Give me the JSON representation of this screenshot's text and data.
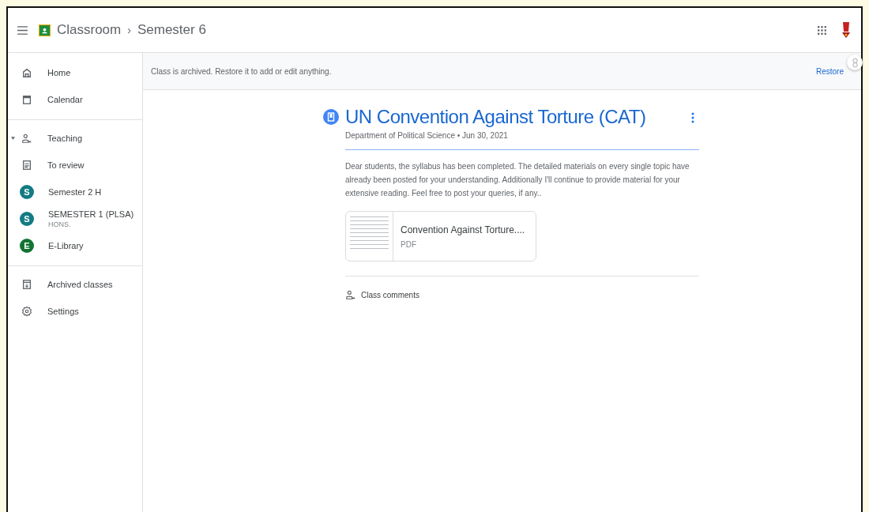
{
  "header": {
    "app_name": "Classroom",
    "separator": "›",
    "class_name": "Semester 6"
  },
  "sidebar": {
    "groups": [
      {
        "items": [
          {
            "kind": "home",
            "label": "Home"
          },
          {
            "kind": "calendar",
            "label": "Calendar"
          }
        ]
      },
      {
        "items": [
          {
            "kind": "section",
            "label": "Teaching",
            "expanded": true
          },
          {
            "kind": "review",
            "label": "To review"
          },
          {
            "kind": "class",
            "initial": "S",
            "color": "#137b84",
            "label": "Semester 2 H"
          },
          {
            "kind": "class",
            "initial": "S",
            "color": "#137b84",
            "label": "SEMESTER 1 (PLSA)",
            "sub": "HONS."
          },
          {
            "kind": "class",
            "initial": "E",
            "color": "#137333",
            "label": "E-Library"
          }
        ]
      },
      {
        "items": [
          {
            "kind": "archive",
            "label": "Archived classes"
          },
          {
            "kind": "settings",
            "label": "Settings"
          }
        ]
      }
    ]
  },
  "banner": {
    "message": "Class is archived. Restore it to add or edit anything.",
    "action": "Restore"
  },
  "post": {
    "title": "UN Convention Against Torture (CAT)",
    "meta": "Department of Political Science • Jun 30, 2021",
    "body": "Dear students, the syllabus has been completed. The detailed materials on every single topic have already been posted for your understanding. Additionally I'll continue to provide material for your extensive reading. Feel free to post your queries, if any..",
    "attachment": {
      "name": "Convention Against Torture....",
      "type": "PDF"
    },
    "comments_label": "Class comments"
  }
}
